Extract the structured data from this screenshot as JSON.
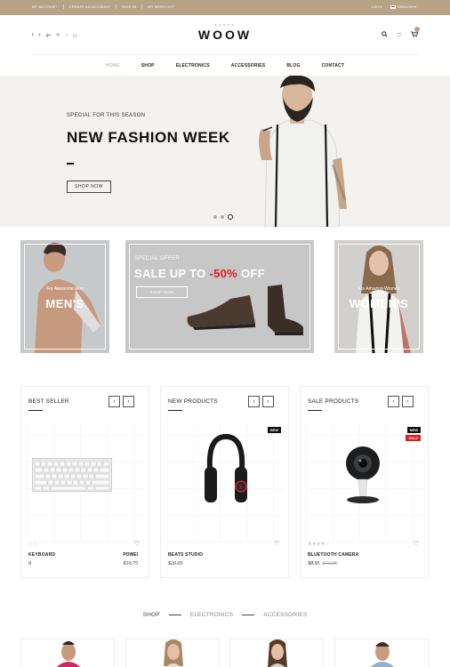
{
  "topbar": {
    "links": [
      "MY ACCOUNT",
      "CREATE AN ACCOUNT",
      "SIGN IN",
      "MY WISH LIST"
    ],
    "currency": "USD",
    "language": "ENGLISH"
  },
  "header": {
    "logo": "WOOW",
    "logo_stars": "★★★★★",
    "social_icons": [
      "facebook-icon",
      "twitter-icon",
      "google-plus-icon",
      "pinterest-icon",
      "rss-icon",
      "instagram-icon"
    ]
  },
  "nav": {
    "items": [
      "HOME",
      "SHOP",
      "ELECTRONICS",
      "ACCESSORIES",
      "BLOG",
      "CONTACT"
    ]
  },
  "hero": {
    "subtitle": "SPECIAL FOR THIS SEASON",
    "title": "NEW FASHION WEEK",
    "button": "SHOP NOW",
    "slides": 3,
    "active_slide": 3
  },
  "banners": {
    "men": {
      "tag": "For Awesome Men",
      "title": "MEN'S"
    },
    "sale": {
      "label": "SPECIAL OFFER",
      "title_prefix": "SALE UP TO",
      "discount": "-50%",
      "title_suffix": "OFF",
      "button": "SHOP NOW"
    },
    "women": {
      "tag": "For Amazing Women",
      "title": "WOMEN'S"
    }
  },
  "products": {
    "best_seller": {
      "title": "BEST SELLER",
      "item": {
        "name": "KEYBOARD",
        "price": "0",
        "rating": "☆☆"
      },
      "peek": {
        "name": "POWEI",
        "price": "$10.75"
      }
    },
    "new_products": {
      "title": "NEW PRODUCTS",
      "item": {
        "name": "BEATS STUDIO",
        "price": "$20.05",
        "badge": "NEW"
      }
    },
    "sale_products": {
      "title": "SALE PRODUCTS",
      "item": {
        "name": "BLUETOOTH CAMERA",
        "price": "$8.95",
        "old_price": "$10.05",
        "rating": "★★★★☆",
        "badge_new": "NEW",
        "badge_sale": "SALE"
      }
    }
  },
  "category_tabs": [
    "SHOP",
    "ELECTRONICS",
    "ACCESSORIES"
  ],
  "colors": {
    "accent": "#b7a386",
    "sale": "#d62020",
    "dark": "#111111"
  }
}
